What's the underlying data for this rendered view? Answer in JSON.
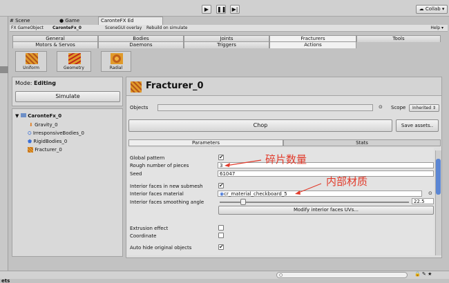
{
  "toolbar": {
    "collab": "Collab"
  },
  "editor_tabs": [
    "Scene",
    "Game",
    "CaronteFX Ed"
  ],
  "scene_toolbar": {
    "fx_gameobject": "FX GameObject",
    "gameobject_value": "CaronteFx_0",
    "scenegui": "SceneGUI overlay",
    "rebuild": "Rebuild on simulate",
    "help": "Help"
  },
  "tabs_row1": [
    "General",
    "Bodies",
    "Joints",
    "Fracturers",
    "Tools"
  ],
  "tabs_row2": [
    "Motors & Servos",
    "Daemons",
    "Triggers",
    "Actions"
  ],
  "tool_icons": [
    "Uniform",
    "Geometry",
    "Radial"
  ],
  "mode": {
    "label": "Mode:",
    "value": "Editing"
  },
  "simulate": "Simulate",
  "hierarchy": {
    "root": "CaronteFx_0",
    "items": [
      "Gravity_0",
      "IrresponsiveBodies_0",
      "RigidBodies_0",
      "Fracturer_0"
    ]
  },
  "inspector": {
    "title": "Fracturer_0",
    "objects_label": "Objects",
    "scope_label": "Scope",
    "scope_value": "Inherited",
    "chop": "Chop",
    "save_assets": "Save assets..",
    "subtabs": [
      "Parameters",
      "Stats"
    ],
    "fields": {
      "global_pattern": "Global pattern",
      "rough_pieces": "Rough number of pieces",
      "rough_pieces_value": "3",
      "seed": "Seed",
      "seed_value": "61047",
      "interior_submesh": "Interior faces in new submesh",
      "interior_material": "Interior faces material",
      "interior_material_value": "cr_material_checkboard_5",
      "smoothing": "Interior faces smoothing angle",
      "smoothing_value": "22.5",
      "modify_uvs": "Modify interior faces UVs...",
      "extrusion": "Extrusion effect",
      "coordinate": "Coordinate",
      "auto_hide": "Auto hide original objects"
    },
    "smoothing_slider_fraction": 0.125
  },
  "annotations": {
    "pieces": "碎片数量",
    "material": "内部材质"
  },
  "bottom": {
    "label": "ets"
  },
  "colors": {
    "accent": "#3b6fd6",
    "annotation": "#e23a2a",
    "fracturer_icon": "#d88a1e"
  }
}
